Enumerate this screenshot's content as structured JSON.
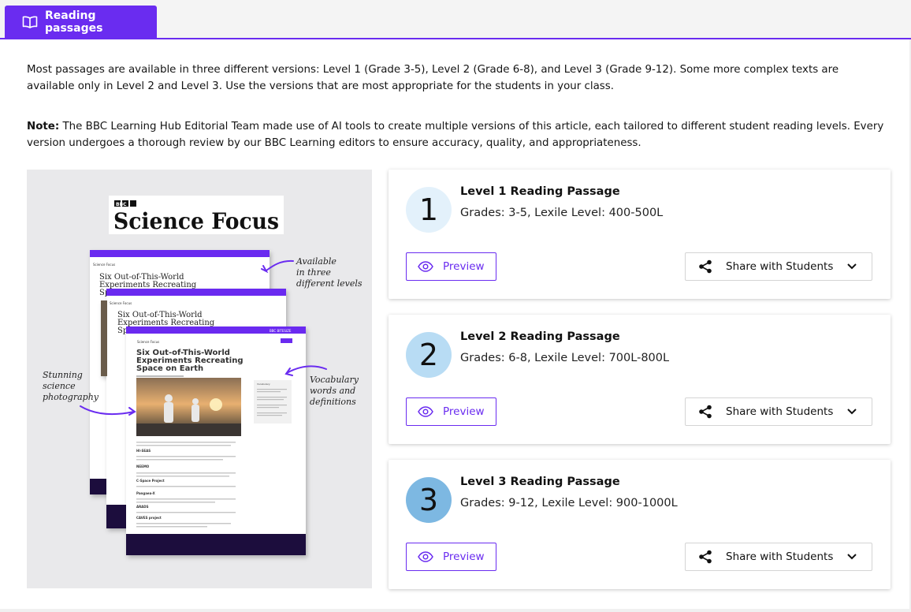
{
  "tab": {
    "label": "Reading passages",
    "icon": "book-open-icon"
  },
  "intro": {
    "text": "Most passages are available in three different versions: Level 1 (Grade 3-5), Level 2 (Grade 6-8), and Level 3 (Grade 9-12). Some more complex texts are available only in Level 2 and Level 3. Use the versions that are most appropriate for the students in your class.",
    "note_label": "Note:",
    "note_text": " The BBC Learning Hub Editorial Team made use of AI tools to create multiple versions of this article, each tailored to different student reading levels. Every version undergoes a thorough review by our BBC Learning editors to ensure accuracy, quality, and appropriateness."
  },
  "hero": {
    "brand_bbc": "BBC",
    "brand_name": "Science Focus",
    "article_title_1": "Six Out-of-This-World",
    "article_title_2": "Experiments Recreating",
    "article_title_3": "Space on Earth",
    "stub_sp": "Sp",
    "doc_brand": "Science Focus",
    "bitesize": "BBC BITESIZE",
    "annot_levels_1": "Available",
    "annot_levels_2": "in three",
    "annot_levels_3": "different levels",
    "annot_photo_1": "Stunning",
    "annot_photo_2": "science",
    "annot_photo_3": "photography",
    "annot_vocab_1": "Vocabulary",
    "annot_vocab_2": "words and",
    "annot_vocab_3": "definitions",
    "sec_hiseas": "HI-SEAS",
    "sec_neemo": "NEEMO",
    "sec_cspace": "C-Space Project",
    "sec_pangaea": "Pangaea-X",
    "sec_arads": "ARADS",
    "sec_caves": "CAVES project",
    "vocab_heading": "Vocabulary"
  },
  "passages": [
    {
      "number": "1",
      "title": "Level 1 Reading Passage",
      "grades": "Grades: 3-5, Lexile Level: 400-500L",
      "preview_label": "Preview",
      "share_label": "Share with Students"
    },
    {
      "number": "2",
      "title": "Level 2 Reading Passage",
      "grades": "Grades: 6-8, Lexile Level: 700L-800L",
      "preview_label": "Preview",
      "share_label": "Share with Students"
    },
    {
      "number": "3",
      "title": "Level 3 Reading Passage",
      "grades": "Grades: 9-12, Lexile Level: 900-1000L",
      "preview_label": "Preview",
      "share_label": "Share with Students"
    }
  ],
  "colors": {
    "accent": "#6a2cf0",
    "circle_1": "#e3f1fb",
    "circle_2": "#b8dcf4",
    "circle_3": "#7db8e2",
    "footer": "#1a0a3d"
  }
}
